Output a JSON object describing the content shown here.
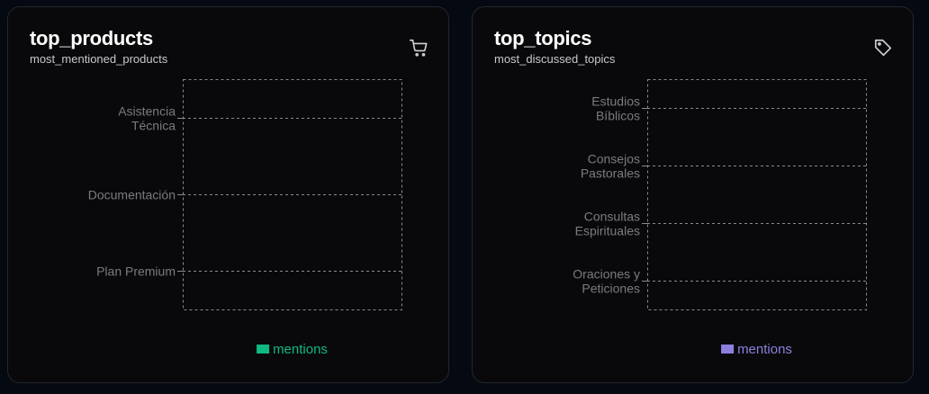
{
  "cards": [
    {
      "title": "top_products",
      "subtitle": "most_mentioned_products",
      "icon": "shopping-cart-icon",
      "chart_data": {
        "type": "bar",
        "orientation": "horizontal",
        "categories": [
          "Asistencia Técnica",
          "Documentación",
          "Plan Premium"
        ],
        "series": [
          {
            "name": "mentions",
            "values": [
              0,
              0,
              0
            ],
            "color": "#10b981"
          }
        ],
        "grid": true,
        "legend": "bottom"
      }
    },
    {
      "title": "top_topics",
      "subtitle": "most_discussed_topics",
      "icon": "tag-icon",
      "chart_data": {
        "type": "bar",
        "orientation": "horizontal",
        "categories": [
          "Estudios Bíblicos",
          "Consejos Pastorales",
          "Consultas Espirituales",
          "Oraciones y Peticiones"
        ],
        "series": [
          {
            "name": "mentions",
            "values": [
              0,
              0,
              0,
              0
            ],
            "color": "#8b80e0"
          }
        ],
        "grid": true,
        "legend": "bottom"
      }
    }
  ]
}
